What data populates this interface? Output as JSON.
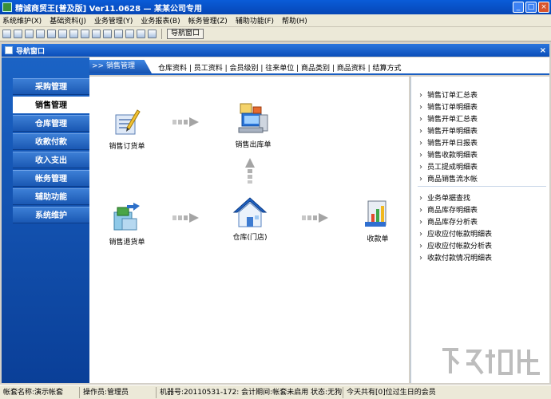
{
  "window": {
    "title": "精诚商贸王[普及版] Ver11.0628 — 某某公司专用"
  },
  "menu": [
    "系统维护(X)",
    "基础资料(J)",
    "业务管理(Y)",
    "业务报表(B)",
    "帐务管理(Z)",
    "辅助功能(F)",
    "帮助(H)"
  ],
  "toolbar": {
    "nav_button": "导航窗口"
  },
  "nav_window": {
    "title": "导航窗口"
  },
  "left_nav": {
    "items": [
      "采购管理",
      "销售管理",
      "仓库管理",
      "收款付款",
      "收入支出",
      "帐务管理",
      "辅助功能",
      "系统维护"
    ],
    "active_index": 1
  },
  "tabs": {
    "current": ">> 销售管理",
    "links": "仓库资料 | 员工资料 | 会员级别 | 往来单位 | 商品类别 | 商品资料 | 结算方式"
  },
  "flow": {
    "order": "销售订货单",
    "out": "销售出库单",
    "return": "销售退货单",
    "warehouse": "仓库(门店)",
    "receipt": "收款单"
  },
  "reports": {
    "group1": [
      "销售订单汇总表",
      "销售订单明细表",
      "销售开单汇总表",
      "销售开单明细表",
      "销售开单日报表",
      "销售收款明细表",
      "员工提成明细表",
      "商品销售流水帐"
    ],
    "group2": [
      "业务单据查找",
      "商品库存明细表",
      "商品库存分析表",
      "应收应付帐款明细表",
      "应收应付帐款分析表",
      "收款付款情况明细表"
    ]
  },
  "status": {
    "account": "帐套名称:演示帐套",
    "operator": "操作员:管理员",
    "machine": "机器号:20110531-172: 会计期间:帐套未启用  状态:无狗",
    "birthday": "今天共有[0]位过生日的会员"
  },
  "colors": {
    "title_blue": "#0a5cd8",
    "nav_blue": "#1b63c5"
  }
}
